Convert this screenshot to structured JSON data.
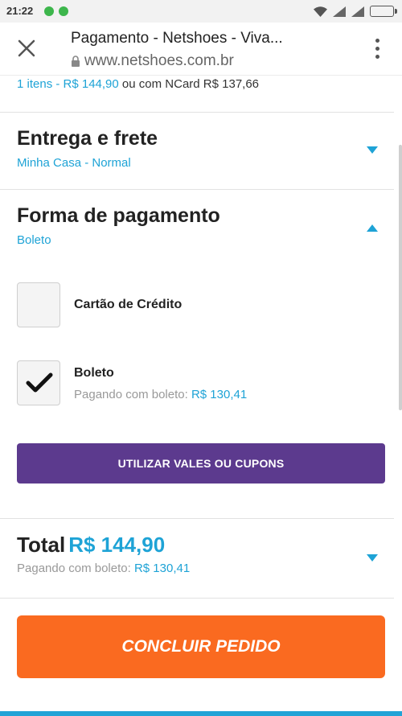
{
  "status_bar": {
    "time": "21:22"
  },
  "browser": {
    "title": "Pagamento - Netshoes - Viva...",
    "url": "www.netshoes.com.br"
  },
  "summary": {
    "items": "1 itens - R$ 144,90",
    "ncard": "ou com NCard R$ 137,66"
  },
  "delivery": {
    "title": "Entrega e frete",
    "subtitle": "Minha Casa - Normal"
  },
  "payment": {
    "title": "Forma de pagamento",
    "subtitle": "Boleto",
    "options": [
      {
        "label": "Cartão de Crédito",
        "checked": false
      },
      {
        "label": "Boleto",
        "checked": true,
        "note_prefix": "Pagando com boleto:",
        "note_value": "R$ 130,41"
      }
    ],
    "coupon_button": "UTILIZAR VALES OU CUPONS"
  },
  "total": {
    "label": "Total",
    "value": "R$ 144,90",
    "note_prefix": "Pagando com boleto:",
    "note_value": "R$ 130,41"
  },
  "conclude_button": "CONCLUIR PEDIDO",
  "colors": {
    "accent_blue": "#1ea3d6",
    "coupon_purple": "#5c3a8e",
    "conclude_orange": "#fa6a20"
  }
}
